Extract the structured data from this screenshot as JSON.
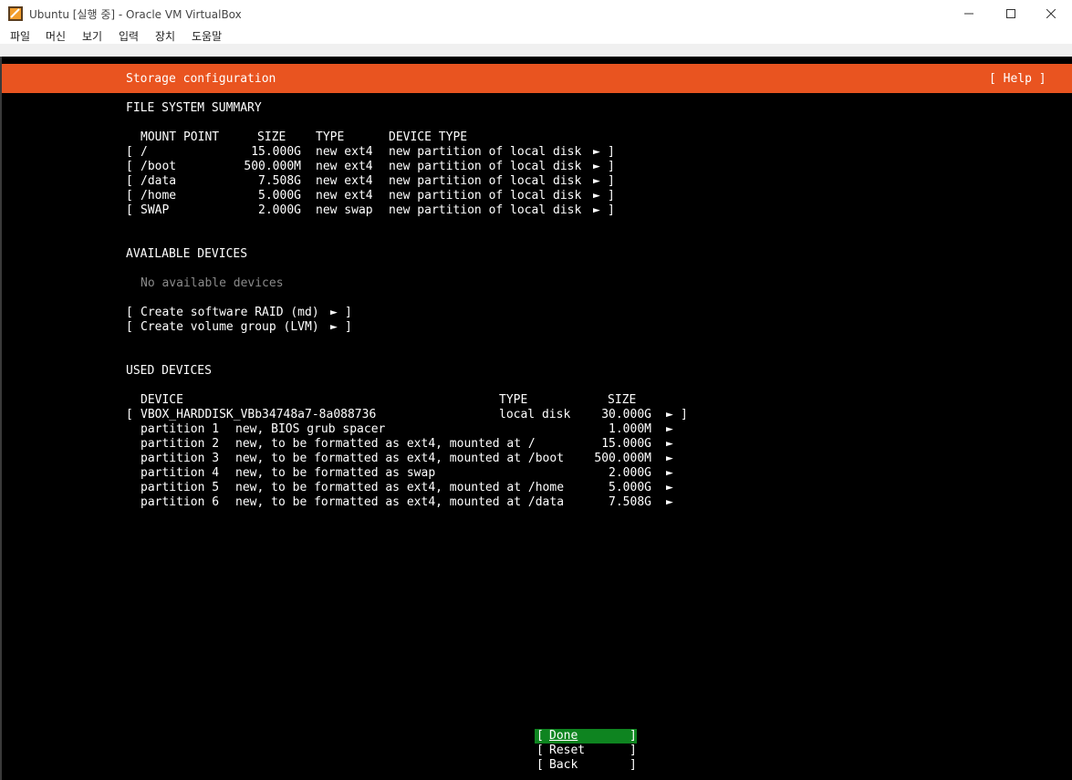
{
  "window": {
    "title": "Ubuntu [실행 중] - Oracle VM VirtualBox",
    "controls": [
      "minimize",
      "maximize",
      "close"
    ]
  },
  "menubar": [
    "파일",
    "머신",
    "보기",
    "입력",
    "장치",
    "도움말"
  ],
  "colors": {
    "header": "#e95420",
    "selected_button": "#0e8420",
    "screen": "#000000"
  },
  "header": {
    "title": "Storage configuration",
    "help": "[ Help ]"
  },
  "fs_summary": {
    "heading": "FILE SYSTEM SUMMARY",
    "columns": [
      "MOUNT POINT",
      "SIZE",
      "TYPE",
      "DEVICE TYPE"
    ],
    "rows": [
      {
        "mount": "/",
        "size": "15.000G",
        "type": "new ext4",
        "device_type": "new partition of local disk"
      },
      {
        "mount": "/boot",
        "size": "500.000M",
        "type": "new ext4",
        "device_type": "new partition of local disk"
      },
      {
        "mount": "/data",
        "size": "7.508G",
        "type": "new ext4",
        "device_type": "new partition of local disk"
      },
      {
        "mount": "/home",
        "size": "5.000G",
        "type": "new ext4",
        "device_type": "new partition of local disk"
      },
      {
        "mount": "SWAP",
        "size": "2.000G",
        "type": "new swap",
        "device_type": "new partition of local disk"
      }
    ]
  },
  "available": {
    "heading": "AVAILABLE DEVICES",
    "empty": "No available devices",
    "actions": [
      "Create software RAID (md)",
      "Create volume group (LVM)"
    ]
  },
  "used": {
    "heading": "USED DEVICES",
    "columns": [
      "DEVICE",
      "TYPE",
      "SIZE"
    ],
    "disk": {
      "name": "VBOX_HARDDISK_VBb34748a7-8a088736",
      "type": "local disk",
      "size": "30.000G"
    },
    "partitions": [
      {
        "name": "partition 1",
        "desc": "new, BIOS grub spacer",
        "size": "1.000M"
      },
      {
        "name": "partition 2",
        "desc": "new, to be formatted as ext4, mounted at /",
        "size": "15.000G"
      },
      {
        "name": "partition 3",
        "desc": "new, to be formatted as ext4, mounted at /boot",
        "size": "500.000M"
      },
      {
        "name": "partition 4",
        "desc": "new, to be formatted as swap",
        "size": "2.000G"
      },
      {
        "name": "partition 5",
        "desc": "new, to be formatted as ext4, mounted at /home",
        "size": "5.000G"
      },
      {
        "name": "partition 6",
        "desc": "new, to be formatted as ext4, mounted at /data",
        "size": "7.508G"
      }
    ]
  },
  "buttons": {
    "done": "Done",
    "reset": "Reset",
    "back": "Back"
  },
  "glyphs": {
    "arrow": "►",
    "open": "[",
    "close": "]"
  }
}
